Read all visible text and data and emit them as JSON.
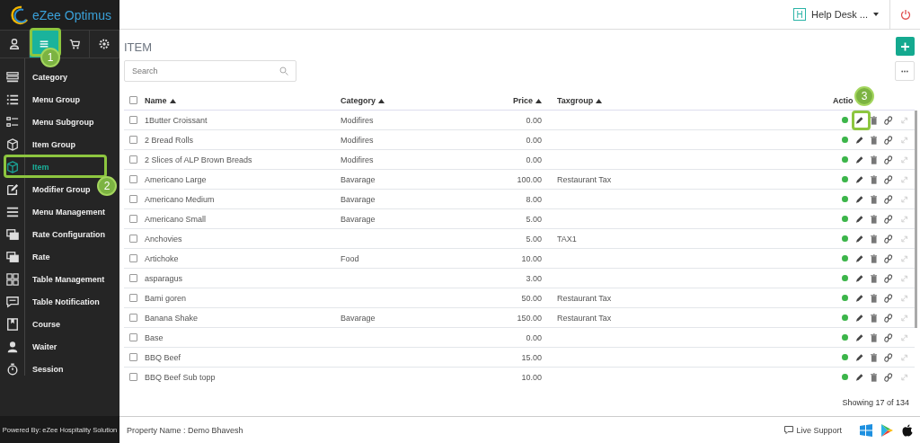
{
  "sidebar": {
    "logo": "eZee Optimus",
    "tabs": [
      {
        "kind": "user",
        "selected": false
      },
      {
        "kind": "menu",
        "selected": true
      },
      {
        "kind": "cart",
        "selected": false
      },
      {
        "kind": "settings",
        "selected": false
      }
    ],
    "items": [
      {
        "label": "Category",
        "selected": false
      },
      {
        "label": "Menu Group",
        "selected": false
      },
      {
        "label": "Menu Subgroup",
        "selected": false
      },
      {
        "label": "Item Group",
        "selected": false
      },
      {
        "label": "Item",
        "selected": true
      },
      {
        "label": "Modifier Group",
        "selected": false
      },
      {
        "label": "Menu Management",
        "selected": false
      },
      {
        "label": "Rate Configuration",
        "selected": false
      },
      {
        "label": "Rate",
        "selected": false
      },
      {
        "label": "Table Management",
        "selected": false
      },
      {
        "label": "Table Notification",
        "selected": false
      },
      {
        "label": "Course",
        "selected": false
      },
      {
        "label": "Waiter",
        "selected": false
      },
      {
        "label": "Session",
        "selected": false
      }
    ],
    "footer": "Powered By: eZee Hospitality Solution"
  },
  "header": {
    "badge": "H",
    "user": "Help Desk ..."
  },
  "page": {
    "title": "ITEM",
    "search": {
      "placeholder": "Search"
    },
    "table": {
      "all_checked": false,
      "columns": [
        {
          "label": "Name",
          "sortable": true
        },
        {
          "label": "Category",
          "sortable": true
        },
        {
          "label": "Price",
          "sortable": true
        },
        {
          "label": "Taxgroup",
          "sortable": true
        },
        {
          "label": "Actio",
          "sortable": false
        }
      ],
      "rows": [
        {
          "name": "1Butter Croissant",
          "category": "Modifires",
          "price": "0.00",
          "taxgroup": "",
          "active": true,
          "checked": false
        },
        {
          "name": "2 Bread Rolls",
          "category": "Modifires",
          "price": "0.00",
          "taxgroup": "",
          "active": true,
          "checked": false
        },
        {
          "name": "2 Slices of ALP Brown Breads",
          "category": "Modifires",
          "price": "0.00",
          "taxgroup": "",
          "active": true,
          "checked": false
        },
        {
          "name": "Americano Large",
          "category": "Bavarage",
          "price": "100.00",
          "taxgroup": "Restaurant Tax",
          "active": true,
          "checked": false
        },
        {
          "name": "Americano Medium",
          "category": "Bavarage",
          "price": "8.00",
          "taxgroup": "",
          "active": true,
          "checked": false
        },
        {
          "name": "Americano Small",
          "category": "Bavarage",
          "price": "5.00",
          "taxgroup": "",
          "active": true,
          "checked": false
        },
        {
          "name": "Anchovies",
          "category": "",
          "price": "5.00",
          "taxgroup": "TAX1",
          "active": true,
          "checked": false
        },
        {
          "name": "Artichoke",
          "category": "Food",
          "price": "10.00",
          "taxgroup": "",
          "active": true,
          "checked": false
        },
        {
          "name": "asparagus",
          "category": "",
          "price": "3.00",
          "taxgroup": "",
          "active": true,
          "checked": false
        },
        {
          "name": "Bami goren",
          "category": "",
          "price": "50.00",
          "taxgroup": "Restaurant Tax",
          "active": true,
          "checked": false
        },
        {
          "name": "Banana Shake",
          "category": "Bavarage",
          "price": "150.00",
          "taxgroup": "Restaurant Tax",
          "active": true,
          "checked": false
        },
        {
          "name": "Base",
          "category": "",
          "price": "0.00",
          "taxgroup": "",
          "active": true,
          "checked": false
        },
        {
          "name": "BBQ Beef",
          "category": "",
          "price": "15.00",
          "taxgroup": "",
          "active": true,
          "checked": false
        },
        {
          "name": "BBQ Beef Sub topp",
          "category": "",
          "price": "10.00",
          "taxgroup": "",
          "active": true,
          "checked": false
        }
      ]
    },
    "showing": "Showing 17 of 134"
  },
  "footer": {
    "property": "Property Name : Demo Bhavesh",
    "support": "Live Support"
  },
  "annotations": [
    {
      "label": "1"
    },
    {
      "label": "2"
    },
    {
      "label": "3"
    }
  ]
}
